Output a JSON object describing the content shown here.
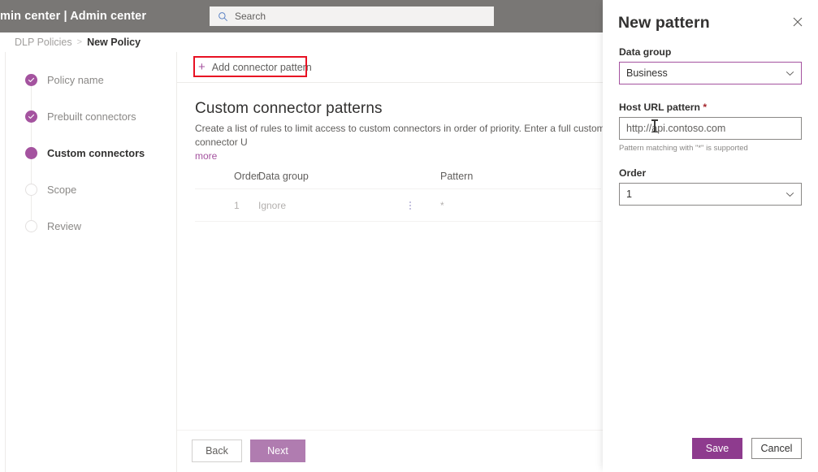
{
  "header": {
    "title": "min center  |  Admin center",
    "search_placeholder": "Search",
    "search_icon": "search-icon"
  },
  "breadcrumb": {
    "parent": "DLP Policies",
    "separator": ">",
    "current": "New Policy"
  },
  "wizard": {
    "steps": [
      {
        "label": "Policy name",
        "state": "done"
      },
      {
        "label": "Prebuilt connectors",
        "state": "done"
      },
      {
        "label": "Custom connectors",
        "state": "current"
      },
      {
        "label": "Scope",
        "state": "todo"
      },
      {
        "label": "Review",
        "state": "todo"
      }
    ]
  },
  "main": {
    "add_button_label": "Add connector pattern",
    "add_button_icon": "plus-icon",
    "section_title": "Custom connector patterns",
    "section_desc": "Create a list of rules to limit access to custom connectors in order of priority. Enter a full custom connector U",
    "learn_more_label": "more",
    "table": {
      "columns": [
        "Order",
        "Data group",
        "",
        "Pattern"
      ],
      "rows": [
        {
          "order": "1",
          "data_group": "Ignore",
          "menu_icon": "vertical-dots-icon",
          "pattern": "*"
        }
      ]
    },
    "footer": {
      "back_label": "Back",
      "next_label": "Next"
    }
  },
  "panel": {
    "title": "New pattern",
    "close_icon": "close-icon",
    "data_group": {
      "label": "Data group",
      "value": "Business",
      "chevron_icon": "chevron-down-icon"
    },
    "host_url": {
      "label": "Host URL pattern",
      "required_marker": "*",
      "value": "",
      "placeholder": "http://api.contoso.com",
      "hint": "Pattern matching with \"*\" is supported"
    },
    "order": {
      "label": "Order",
      "value": "1",
      "chevron_icon": "chevron-down-icon"
    },
    "actions": {
      "save_label": "Save",
      "cancel_label": "Cancel"
    }
  },
  "colors": {
    "brand_purple": "#a4539f",
    "save_purple": "#8e3b8e",
    "next_purple": "#b07cb0",
    "highlight_red": "#e81123",
    "topbar_gray": "#797775"
  }
}
